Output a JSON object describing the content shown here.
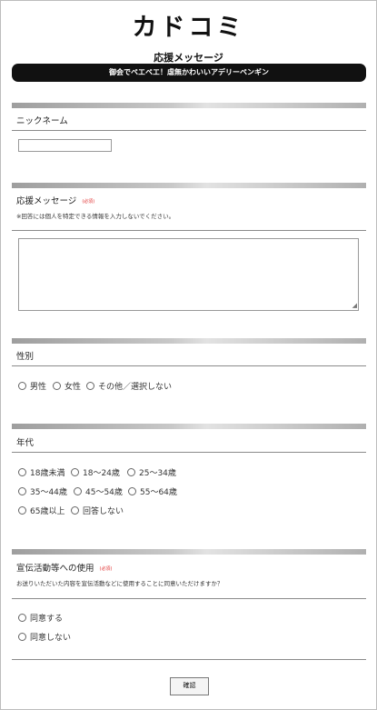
{
  "logo": {
    "text": "カドコミ"
  },
  "page_title": "応援メッセージ",
  "banner": "御会でペエペエ！虐無かわいいアデリーペンギン",
  "sections": {
    "nickname": {
      "label": "ニックネーム",
      "value": ""
    },
    "message": {
      "label": "応援メッセージ",
      "required": "(必須)",
      "note": "※回答には個人を特定できる情報を入力しないでください。",
      "value": ""
    },
    "gender": {
      "label": "性別",
      "options": [
        "男性",
        "女性",
        "その他／選択しない"
      ]
    },
    "age": {
      "label": "年代",
      "options": [
        "18歳未満",
        "18〜24歳",
        "25〜34歳",
        "35〜44歳",
        "45〜54歳",
        "55〜64歳",
        "65歳以上",
        "回答しない"
      ]
    },
    "usage": {
      "label": "宣伝活動等への使用",
      "required": "(必須)",
      "note": "お送りいただいた内容を宣伝活動などに使用することに同意いただけますか？",
      "options": [
        "同意する",
        "同意しない"
      ]
    }
  },
  "confirm_button": "確認"
}
